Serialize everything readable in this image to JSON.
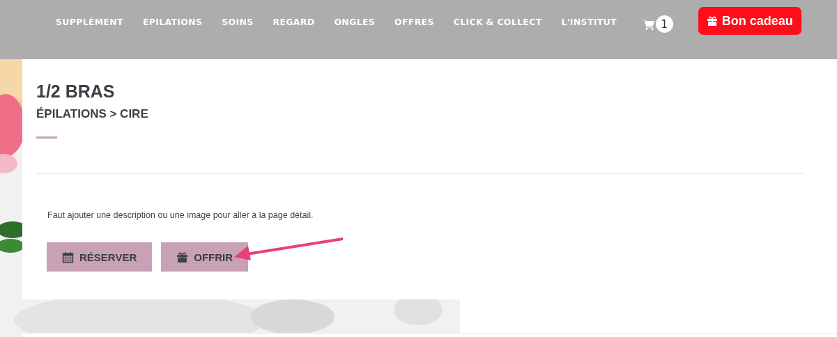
{
  "nav": {
    "items": [
      "SUPPLÉMENT",
      "EPILATIONS",
      "SOINS",
      "REGARD",
      "ONGLES",
      "OFFRES",
      "CLICK & COLLECT",
      "L'INSTITUT"
    ],
    "cart_count": "1",
    "gift_button": "Bon cadeau"
  },
  "product": {
    "title": "1/2 BRAS",
    "breadcrumb": "ÉPILATIONS > CIRE",
    "description": "Faut ajouter une description ou une image pour aller à la page détail.",
    "buttons": [
      {
        "kind": "calendar",
        "label": "RÉSERVER"
      },
      {
        "kind": "gift",
        "label": "OFFRIR"
      }
    ]
  }
}
